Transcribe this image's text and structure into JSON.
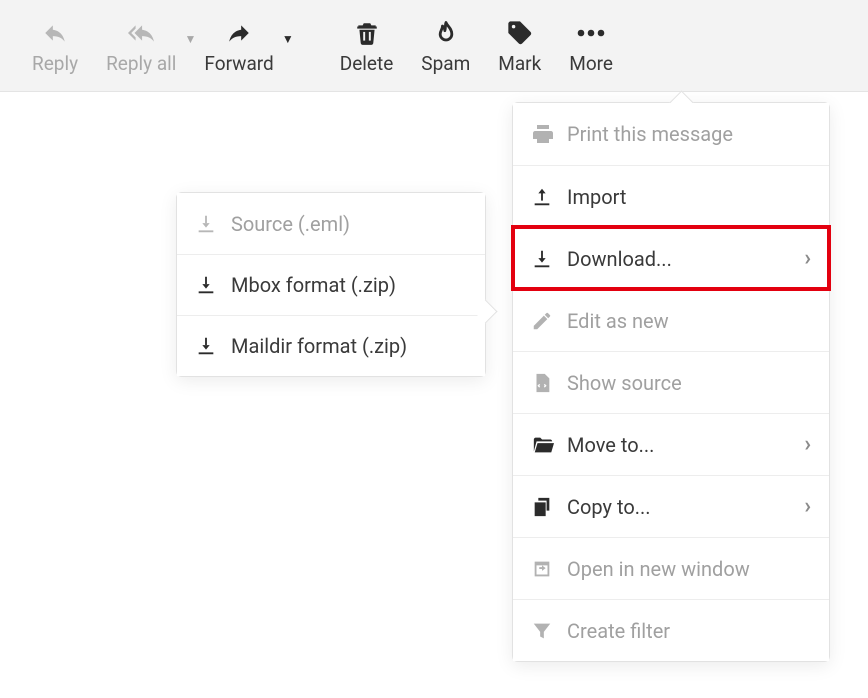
{
  "toolbar": {
    "reply": "Reply",
    "reply_all": "Reply all",
    "forward": "Forward",
    "delete": "Delete",
    "spam": "Spam",
    "mark": "Mark",
    "more": "More"
  },
  "more_menu": {
    "print": "Print this message",
    "import": "Import",
    "download": "Download...",
    "edit_as_new": "Edit as new",
    "show_source": "Show source",
    "move_to": "Move to...",
    "copy_to": "Copy to...",
    "open_new_window": "Open in new window",
    "create_filter": "Create filter"
  },
  "download_submenu": {
    "source_eml": "Source (.eml)",
    "mbox_zip": "Mbox format (.zip)",
    "maildir_zip": "Maildir format (.zip)"
  }
}
